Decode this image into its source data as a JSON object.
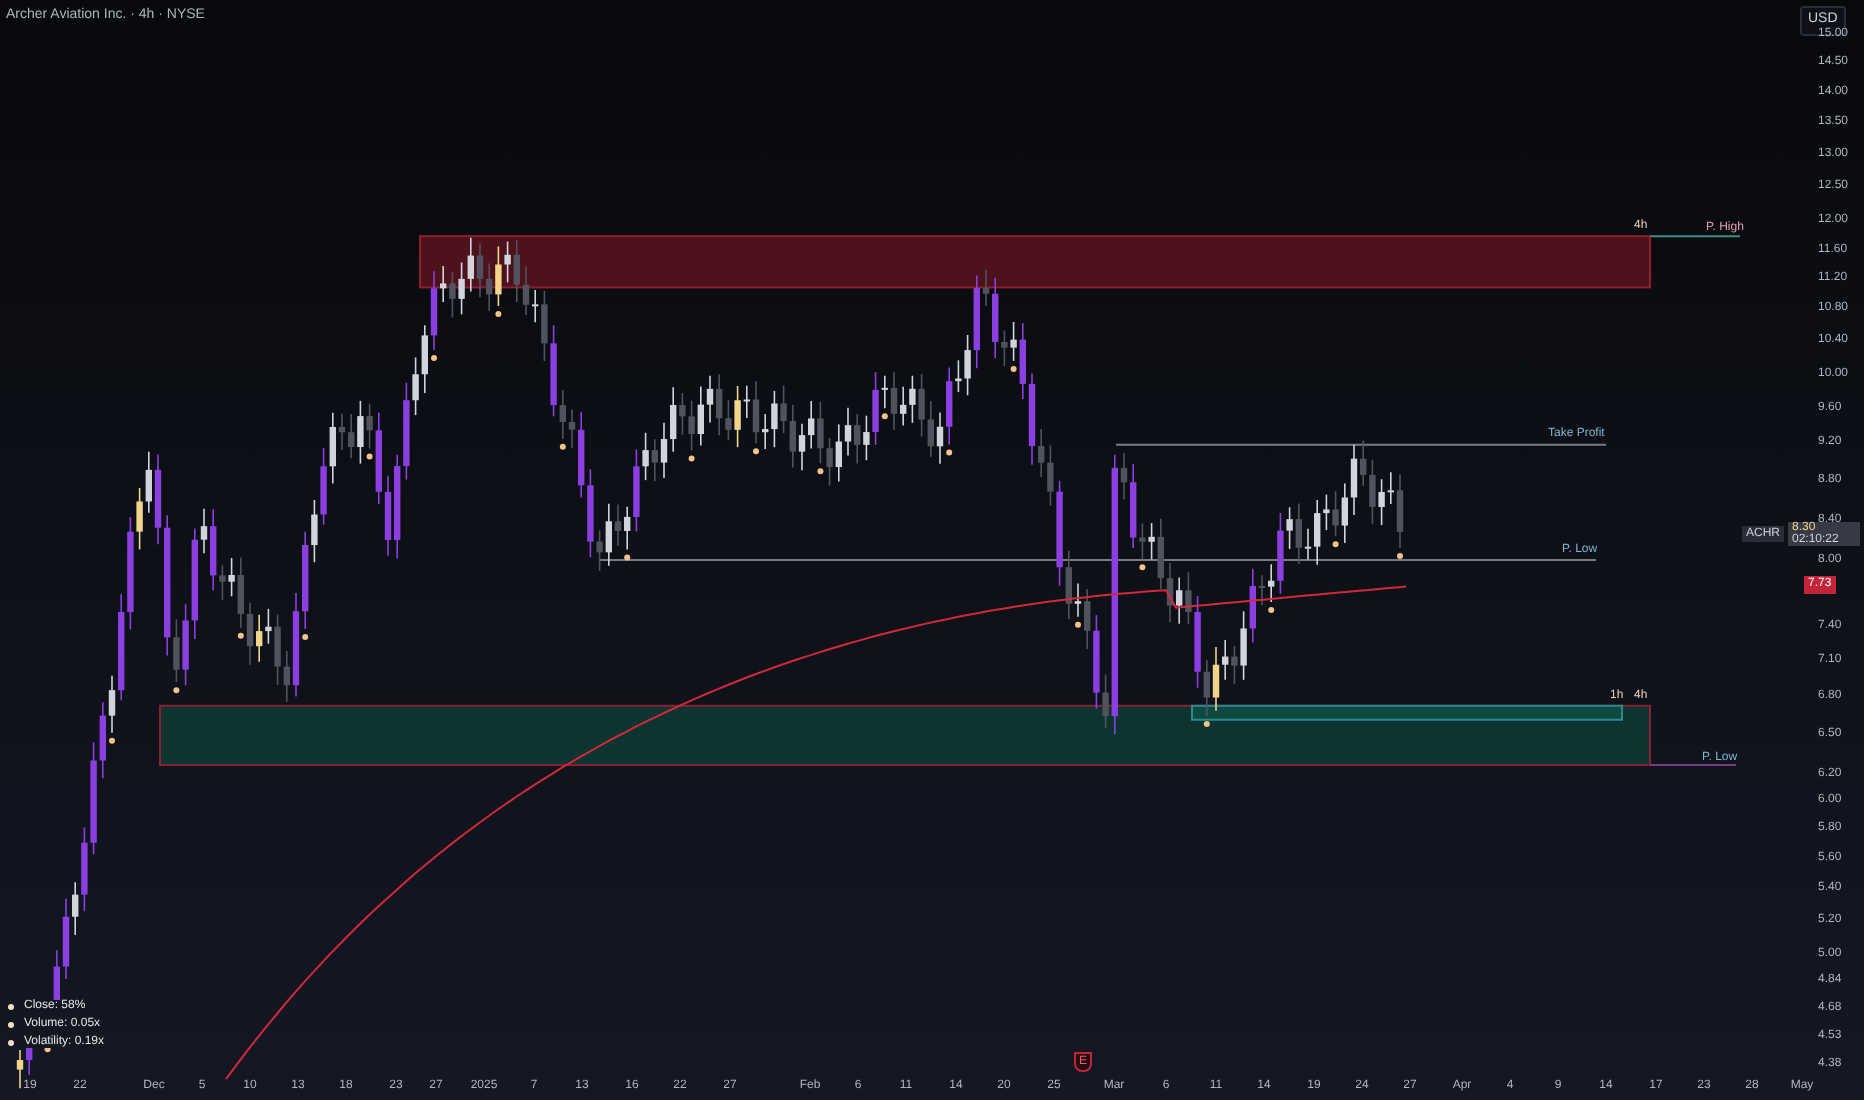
{
  "header": {
    "title": "Archer Aviation Inc. · 4h · NYSE"
  },
  "price_axis": {
    "currency": "USD",
    "ticks": [
      "15.00",
      "14.50",
      "14.00",
      "13.50",
      "13.00",
      "12.50",
      "12.00",
      "11.60",
      "11.20",
      "10.80",
      "10.40",
      "10.00",
      "9.60",
      "9.20",
      "8.80",
      "8.40",
      "8.00",
      "7.40",
      "7.10",
      "6.80",
      "6.50",
      "6.20",
      "6.00",
      "5.80",
      "5.60",
      "5.40",
      "5.20",
      "5.00",
      "4.84",
      "4.68",
      "4.53",
      "4.38"
    ]
  },
  "last_price": {
    "symbol": "ACHR",
    "price": "8.30",
    "countdown": "02:10:22"
  },
  "moving_average_price": "7.73",
  "time_axis": [
    "19",
    "22",
    "Dec",
    "5",
    "10",
    "13",
    "18",
    "23",
    "27",
    "2025",
    "7",
    "13",
    "16",
    "22",
    "27",
    "Feb",
    "6",
    "11",
    "14",
    "20",
    "25",
    "Mar",
    "6",
    "11",
    "14",
    "19",
    "24",
    "27",
    "Apr",
    "4",
    "9",
    "14",
    "17",
    "23",
    "28",
    "May"
  ],
  "zones": [
    {
      "kind": "supply",
      "timeframes": [
        "4h"
      ],
      "label": "P. High"
    },
    {
      "kind": "demand",
      "timeframes": [
        "1h",
        "4h"
      ],
      "label": "P. Low"
    }
  ],
  "levels": [
    {
      "label": "Take Profit"
    },
    {
      "label": "P. Low"
    }
  ],
  "legend": [
    {
      "text": "Close: 58%"
    },
    {
      "text": "Volume: 0.05x"
    },
    {
      "text": "Volatility: 0.19x"
    }
  ],
  "events": [
    {
      "kind": "earnings",
      "label": "E"
    }
  ]
}
